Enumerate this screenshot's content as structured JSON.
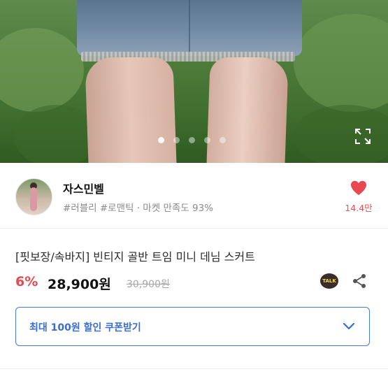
{
  "product_image": {
    "slide_count": 5,
    "active_slide": 1,
    "expand_icon": "expand-icon"
  },
  "seller": {
    "name": "자스민벨",
    "tags": "#러블리 #로맨틱 · 마켓 만족도 93%",
    "likes": "14.4만",
    "heart_icon": "heart-icon",
    "heart_color": "#e8484f"
  },
  "product": {
    "title": "[핏보장/속바지] 빈티지 골반 트임 미니 데님 스커트",
    "discount": "6%",
    "price": "28,900원",
    "original_price": "30,900원",
    "talk_label": "TALK",
    "share_icon": "share-icon"
  },
  "coupon": {
    "label": "최대 100원 할인 쿠폰받기",
    "chevron_icon": "chevron-down-icon",
    "accent_color": "#3a6dd0"
  }
}
